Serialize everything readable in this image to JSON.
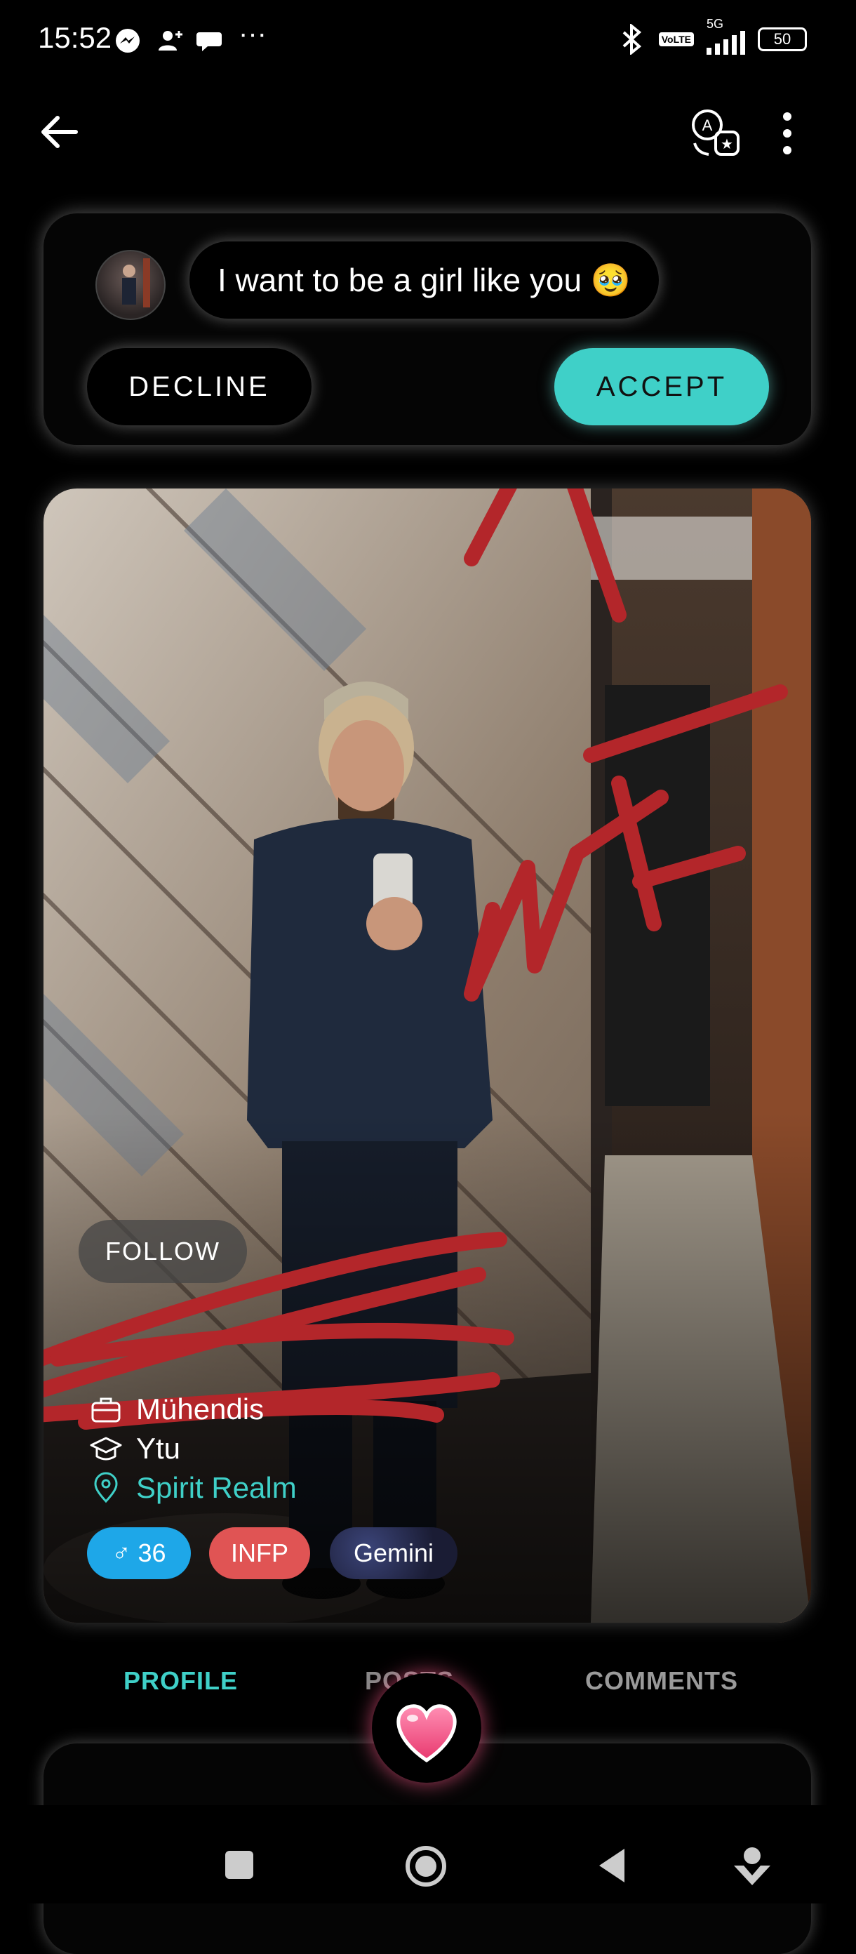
{
  "status_bar": {
    "time": "15:52",
    "more": "···",
    "network": "5G",
    "lte_badge": "VoLTE",
    "battery": "50"
  },
  "request": {
    "message": "I want to be a girl like you 🥹",
    "decline_label": "DECLINE",
    "accept_label": "ACCEPT"
  },
  "profile": {
    "follow_label": "FOLLOW",
    "name": "",
    "job": "Mühendis",
    "school": "Ytu",
    "location": "Spirit Realm",
    "gender_age": "36",
    "mbti": "INFP",
    "zodiac": "Gemini"
  },
  "annotations": {
    "scribble_text": "wtf"
  },
  "tabs": {
    "profile": "PROFILE",
    "posts": "POSTS",
    "comments": "COMMENTS"
  },
  "colors": {
    "accent": "#3fd0c8",
    "gender_chip": "#1ea7e8",
    "mbti_chip": "#e05454",
    "scribble": "#b3262a"
  }
}
